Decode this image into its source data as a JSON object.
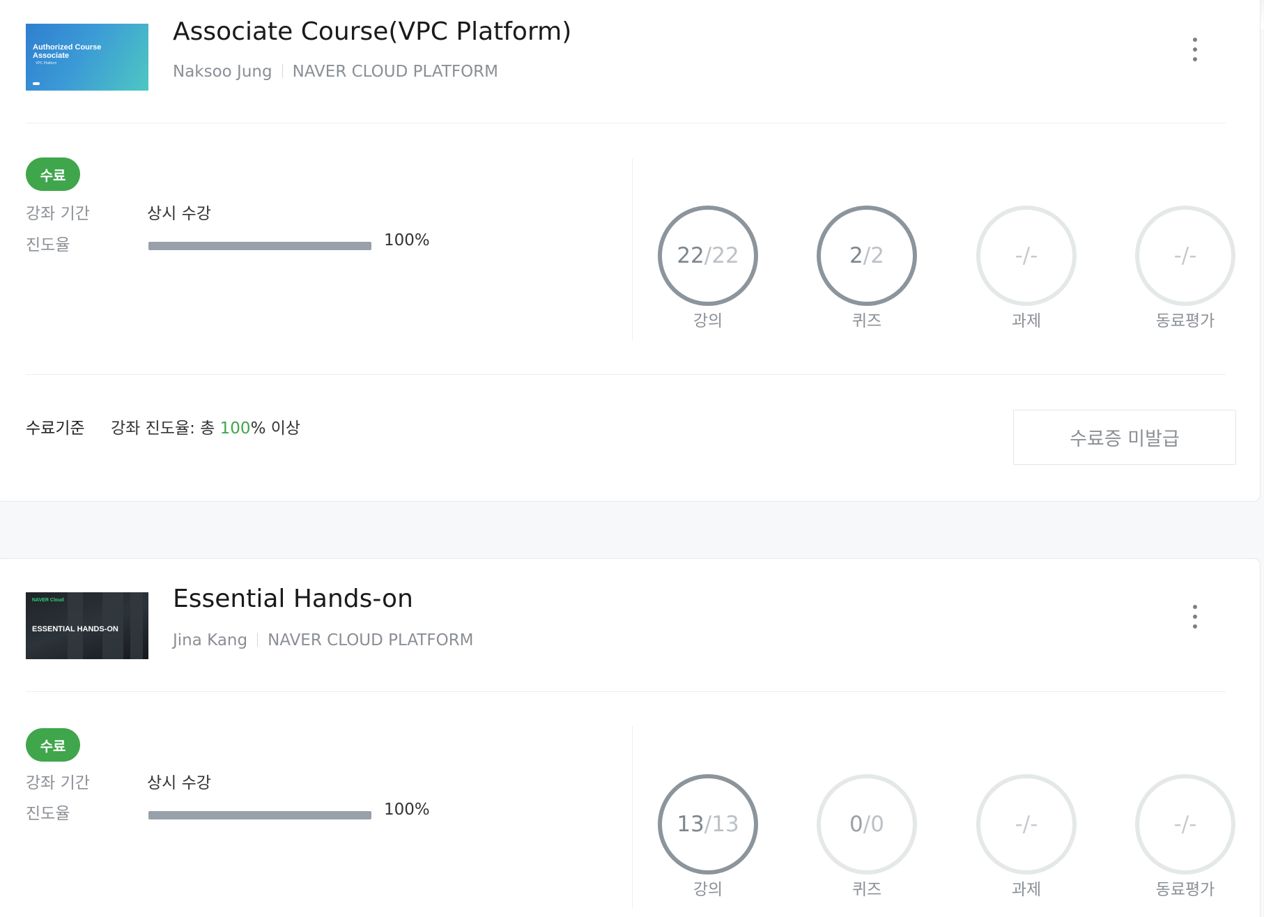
{
  "courses": [
    {
      "thumb": {
        "line1": "Authorized Course",
        "line2": "Associate",
        "line3": "VPC Platform"
      },
      "title": "Associate Course(VPC Platform)",
      "instructor": "Naksoo Jung",
      "provider": "NAVER CLOUD PLATFORM",
      "status_badge": "수료",
      "period_label": "강좌 기간",
      "period_value": "상시 수강",
      "progress_label": "진도율",
      "progress_fraction": 1.0,
      "progress_text": "100%",
      "stats": [
        {
          "num": "22",
          "slash": "/",
          "den": "22",
          "label": "강의",
          "dim": false
        },
        {
          "num": "2",
          "slash": "/",
          "den": "2",
          "label": "퀴즈",
          "dim": false
        },
        {
          "num": "-",
          "slash": "/",
          "den": "-",
          "label": "과제",
          "dim": true
        },
        {
          "num": "-",
          "slash": "/",
          "den": "-",
          "label": "동료평가",
          "dim": true
        }
      ],
      "criteria_label": "수료기준",
      "criteria_prefix": "강좌 진도율: 총 ",
      "criteria_value": "100",
      "criteria_suffix": "% 이상",
      "certificate_button": "수료증 미발급"
    },
    {
      "thumb": {
        "brand": "NAVER Cloud",
        "line1": "ESSENTIAL HANDS-ON"
      },
      "title": "Essential Hands-on",
      "instructor": "Jina Kang",
      "provider": "NAVER CLOUD PLATFORM",
      "status_badge": "수료",
      "period_label": "강좌 기간",
      "period_value": "상시 수강",
      "progress_label": "진도율",
      "progress_fraction": 1.0,
      "progress_text": "100%",
      "stats": [
        {
          "num": "13",
          "slash": "/",
          "den": "13",
          "label": "강의",
          "dim": false
        },
        {
          "num": "0",
          "slash": "/",
          "den": "0",
          "label": "퀴즈",
          "dim": true
        },
        {
          "num": "-",
          "slash": "/",
          "den": "-",
          "label": "과제",
          "dim": true
        },
        {
          "num": "-",
          "slash": "/",
          "den": "-",
          "label": "동료평가",
          "dim": true
        }
      ]
    }
  ],
  "colors": {
    "accent_green": "#3fa64b",
    "ring_active": "#8c949c",
    "ring_inactive": "#e4e8e9"
  },
  "icons": {
    "menu": "kebab-more-icon"
  }
}
